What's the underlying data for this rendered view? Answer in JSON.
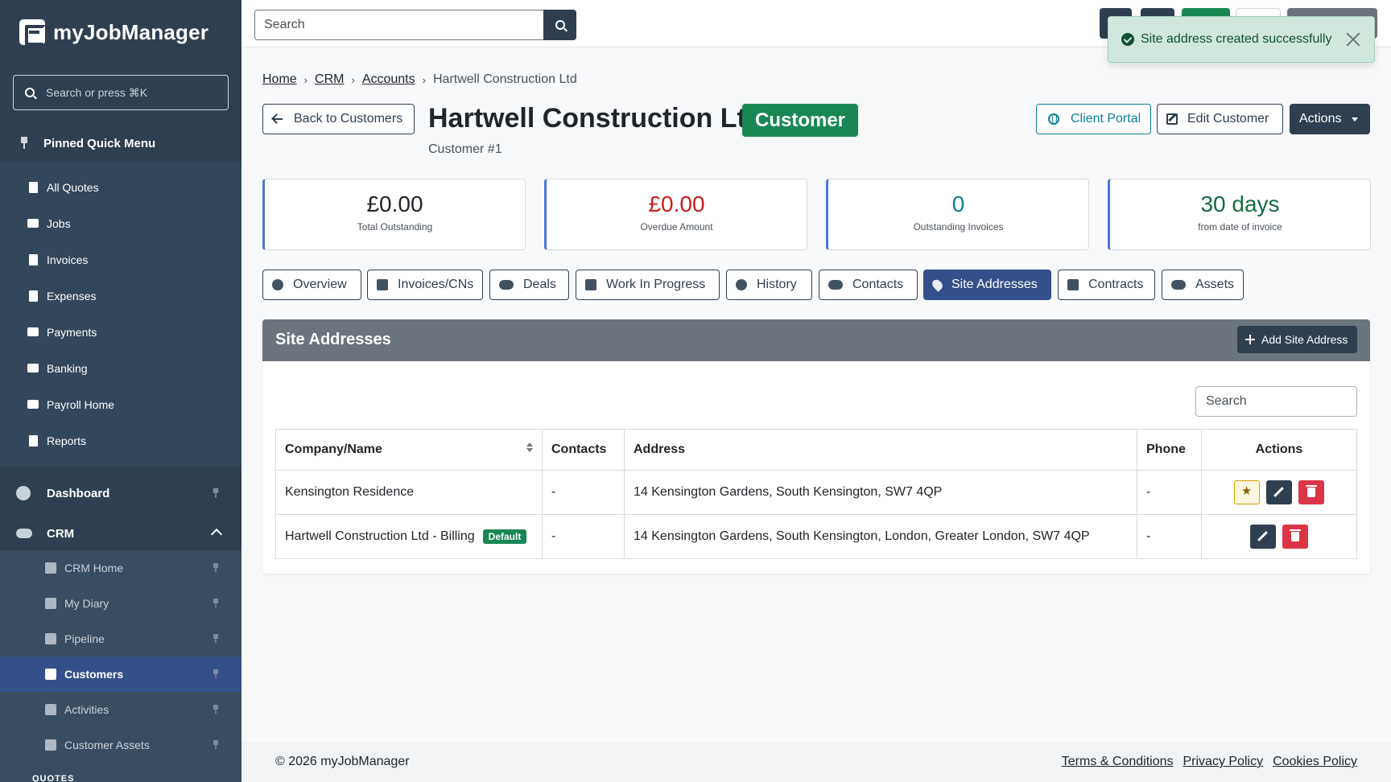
{
  "brand": {
    "name": "myJobManager"
  },
  "sidebar": {
    "search_placeholder": "Search or press ⌘K",
    "pinned_header": "Pinned Quick Menu",
    "pinned_items": [
      {
        "label": "All Quotes",
        "icon": "file-icon"
      },
      {
        "label": "Jobs",
        "icon": "briefcase-icon"
      },
      {
        "label": "Invoices",
        "icon": "file-invoice-icon"
      },
      {
        "label": "Expenses",
        "icon": "receipt-icon"
      },
      {
        "label": "Payments",
        "icon": "credit-card-icon"
      },
      {
        "label": "Banking",
        "icon": "bank-icon"
      },
      {
        "label": "Payroll Home",
        "icon": "money-icon"
      },
      {
        "label": "Reports",
        "icon": "chart-icon"
      }
    ],
    "dashboard_label": "Dashboard",
    "crm_label": "CRM",
    "crm_items": [
      {
        "label": "CRM Home",
        "icon": "home-icon"
      },
      {
        "label": "My Diary",
        "icon": "calendar-icon"
      },
      {
        "label": "Pipeline",
        "icon": "list-icon"
      },
      {
        "label": "Customers",
        "icon": "building-icon",
        "active": true
      },
      {
        "label": "Activities",
        "icon": "calendar-grid-icon"
      },
      {
        "label": "Customer Assets",
        "icon": "assets-icon"
      }
    ],
    "quotes_label": "QUOTES"
  },
  "topbar": {
    "search_placeholder": "Search"
  },
  "toast": {
    "message": "Site address created successfully",
    "color": "#d1e7dd"
  },
  "breadcrumb": {
    "home": "Home",
    "crm": "CRM",
    "accounts": "Accounts",
    "current": "Hartwell Construction Ltd"
  },
  "header": {
    "back_label": "Back to Customers",
    "title": "Hartwell Construction Ltd",
    "badge": "Customer",
    "subtitle": "Customer #1",
    "client_portal": "Client Portal",
    "edit_customer": "Edit Customer",
    "actions": "Actions"
  },
  "stats": [
    {
      "value": "£0.00",
      "label": "Total Outstanding",
      "color": "#212529"
    },
    {
      "value": "£0.00",
      "label": "Overdue Amount",
      "color": "#c81e1e"
    },
    {
      "value": "0",
      "label": "Outstanding Invoices",
      "color": "#0d7e95"
    },
    {
      "value": "30 days",
      "label": "from date of invoice",
      "color": "#146c43"
    }
  ],
  "tabs": [
    {
      "label": "Overview"
    },
    {
      "label": "Invoices/CNs"
    },
    {
      "label": "Deals"
    },
    {
      "label": "Work In Progress"
    },
    {
      "label": "History"
    },
    {
      "label": "Contacts"
    },
    {
      "label": "Site Addresses",
      "active": true
    },
    {
      "label": "Contracts"
    },
    {
      "label": "Assets"
    }
  ],
  "panel": {
    "title": "Site Addresses",
    "add_label": "Add Site Address",
    "search_placeholder": "Search"
  },
  "table": {
    "headers": [
      "Company/Name",
      "Contacts",
      "Address",
      "Phone",
      "Actions"
    ],
    "rows": [
      {
        "name": "Kensington Residence",
        "contacts": "-",
        "address": "14 Kensington Gardens, South Kensington, SW7 4QP",
        "phone": "-",
        "badge": ""
      },
      {
        "name": "Hartwell Construction Ltd - Billing",
        "contacts": "-",
        "address": "14 Kensington Gardens, South Kensington, London, Greater London, SW7 4QP",
        "phone": "-",
        "badge": "Default"
      }
    ]
  },
  "footer": {
    "copyright": "© 2026 myJobManager",
    "terms": "Terms & Conditions",
    "privacy": "Privacy Policy",
    "cookies": "Cookies Policy"
  }
}
